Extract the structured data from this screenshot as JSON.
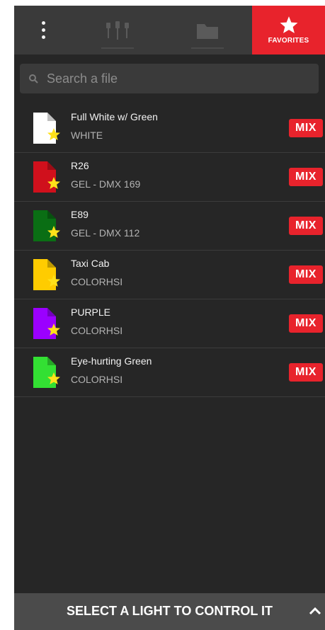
{
  "topbar": {
    "menu_icon": "kebab-menu-icon",
    "fixtures_icon": "fixtures-icon",
    "files_icon": "folder-icon",
    "favorites_icon": "star-icon",
    "favorites_label": "FAVORITES",
    "active_tab": "favorites",
    "accent_color": "#e8232c"
  },
  "search": {
    "placeholder": "Search a file",
    "value": "",
    "icon": "search-icon"
  },
  "files": [
    {
      "name": "Full White w/ Green",
      "type": "WHITE",
      "color": "#ffffff",
      "favorite": true,
      "action": "MIX"
    },
    {
      "name": "R26",
      "type": "GEL - DMX 169",
      "color": "#d0101c",
      "favorite": true,
      "action": "MIX"
    },
    {
      "name": "E89",
      "type": "GEL - DMX 112",
      "color": "#0a6e14",
      "favorite": true,
      "action": "MIX"
    },
    {
      "name": "Taxi Cab",
      "type": "COLORHSI",
      "color": "#ffcc00",
      "favorite": true,
      "action": "MIX"
    },
    {
      "name": "PURPLE",
      "type": "COLORHSI",
      "color": "#9b00ff",
      "favorite": true,
      "action": "MIX"
    },
    {
      "name": "Eye-hurting Green",
      "type": "COLORHSI",
      "color": "#33e033",
      "favorite": true,
      "action": "MIX"
    }
  ],
  "bottombar": {
    "label": "SELECT A LIGHT TO CONTROL IT",
    "icon": "chevron-up-icon"
  }
}
